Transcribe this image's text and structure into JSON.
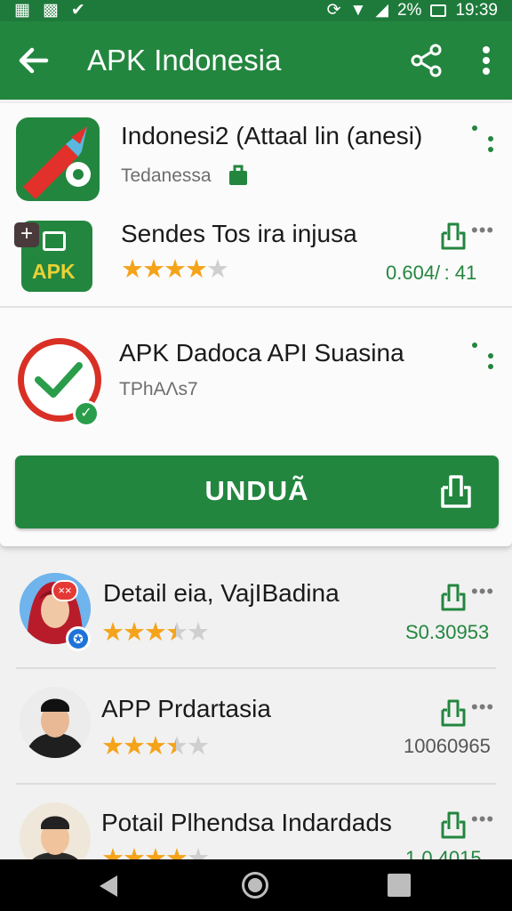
{
  "status_bar": {
    "time": "19:39",
    "battery_text": "2%"
  },
  "app_bar": {
    "title": "APK Indonesia"
  },
  "featured": {
    "title": "Indonesi2 (Attaal lin (anesi)",
    "developer": "Tedanessa"
  },
  "apk_item": {
    "title": "Sendes Tos ira injusa",
    "icon_label": "APK",
    "rating": 4,
    "version": "0.604/ : 41"
  },
  "detail_item": {
    "title": "APK Dadoca API  Suasina",
    "subtitle": "TPhAΛs7"
  },
  "download_button": {
    "label": "UNDUÃ"
  },
  "list": [
    {
      "title": "Detail eia, VajIBadina",
      "rating": 3.5,
      "value": "S0.30953",
      "value_color": "#23863f"
    },
    {
      "title": "APP Prdartasia",
      "rating": 3.5,
      "value": "10060965",
      "value_color": "#555555"
    },
    {
      "title": "Potail Plhendsa Indardads",
      "rating": 4,
      "value": "1.0.4015",
      "value_color": "#23863f"
    }
  ],
  "colors": {
    "primary": "#23863f",
    "status_bar": "#1e7a3b",
    "star": "#f5a31a",
    "accent_red": "#d93025"
  },
  "icons": [
    "back-arrow-icon",
    "share-icon",
    "more-vert-icon",
    "download-bag-icon",
    "overflow-dots-icon",
    "verified-icon"
  ]
}
